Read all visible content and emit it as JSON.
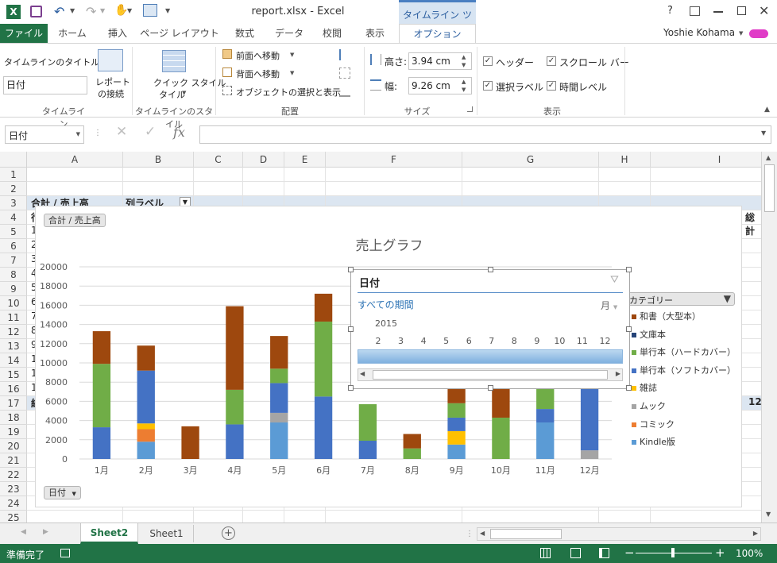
{
  "window": {
    "title": "report.xlsx - Excel",
    "contextual_tab_group": "タイムライン ツール",
    "user": "Yoshie Kohama",
    "help": "?"
  },
  "ribbon_tabs": [
    "ファイル",
    "ホーム",
    "挿入",
    "ページ レイアウト",
    "数式",
    "データ",
    "校閲",
    "表示",
    "オプション"
  ],
  "ribbon": {
    "timeline_group": {
      "caption_label": "タイムラインのタイトル:",
      "caption_value": "日付",
      "connections_label1": "レポート",
      "connections_label2": "の接続",
      "group_label": "タイムライン"
    },
    "styles_group": {
      "quick_styles_label1": "クイック スタイル",
      "quick_styles_label2": "タイル",
      "group_label": "タイムラインのスタイル"
    },
    "arrange_group": {
      "bring_forward": "前面へ移動",
      "send_backward": "背面へ移動",
      "selection_pane": "オブジェクトの選択と表示",
      "group_label": "配置"
    },
    "size_group": {
      "height_label": "高さ:",
      "height_value": "3.94 cm",
      "width_label": "幅:",
      "width_value": "9.26 cm",
      "group_label": "サイズ"
    },
    "show_group": {
      "header": "ヘッダー",
      "selection_label": "選択ラベル",
      "scrollbar": "スクロール バー",
      "time_level": "時間レベル",
      "group_label": "表示"
    }
  },
  "formula_bar": {
    "name_box": "日付",
    "fx": "fx",
    "content": ""
  },
  "columns": [
    "A",
    "B",
    "C",
    "D",
    "E",
    "F",
    "G",
    "H",
    "I"
  ],
  "rows": [
    "1",
    "2",
    "3",
    "4",
    "5",
    "6",
    "7",
    "8",
    "9",
    "10",
    "11",
    "12",
    "13",
    "14",
    "15",
    "16",
    "17",
    "18",
    "19",
    "20",
    "21",
    "22",
    "23",
    "24",
    "25"
  ],
  "cells": {
    "a3": "合計 / 売上高",
    "b3": "列ラベル",
    "a4": "行",
    "a5": "1",
    "a6": "2",
    "a7": "3",
    "a8": "4",
    "a9": "5",
    "a10": "6",
    "a11": "7",
    "a12": "8",
    "a13": "9",
    "a14": "1",
    "a15": "1",
    "a16": "1",
    "a17": "総",
    "j4": "総計",
    "j17": "12"
  },
  "chart": {
    "field_button_top": "合計 / 売上高",
    "field_button_axis": "日付",
    "legend_field": "カテゴリー"
  },
  "chart_data": {
    "type": "bar",
    "stacked": true,
    "title": "売上グラフ",
    "categories": [
      "1月",
      "2月",
      "3月",
      "4月",
      "5月",
      "6月",
      "7月",
      "8月",
      "9月",
      "10月",
      "11月",
      "12月"
    ],
    "ylim": [
      0,
      20000
    ],
    "yticks": [
      "0",
      "2000",
      "4000",
      "6000",
      "8000",
      "10000",
      "12000",
      "14000",
      "16000",
      "18000",
      "20000"
    ],
    "series": [
      {
        "name": "Kindle版",
        "color": "#5b9bd5",
        "values": [
          0,
          1800,
          0,
          0,
          3800,
          0,
          0,
          0,
          1500,
          0,
          3800,
          0
        ]
      },
      {
        "name": "コミック",
        "color": "#ed7d31",
        "values": [
          0,
          1300,
          0,
          0,
          0,
          0,
          0,
          0,
          0,
          0,
          0,
          0
        ]
      },
      {
        "name": "ムック",
        "color": "#a5a5a5",
        "values": [
          0,
          0,
          0,
          0,
          1000,
          0,
          0,
          0,
          0,
          0,
          0,
          900
        ]
      },
      {
        "name": "雑誌",
        "color": "#ffc000",
        "values": [
          0,
          600,
          0,
          0,
          0,
          0,
          0,
          0,
          1400,
          0,
          0,
          0
        ]
      },
      {
        "name": "単行本（ソフトカバー）",
        "color": "#4472c4",
        "values": [
          3300,
          5500,
          0,
          3600,
          3100,
          6500,
          1900,
          0,
          1400,
          0,
          1400,
          6600
        ]
      },
      {
        "name": "単行本（ハードカバー）",
        "color": "#70ad47",
        "values": [
          6600,
          0,
          0,
          3600,
          1500,
          7800,
          3800,
          1100,
          1500,
          4300,
          5800,
          0
        ]
      },
      {
        "name": "文庫本",
        "color": "#264478",
        "values": [
          0,
          0,
          0,
          0,
          0,
          0,
          0,
          0,
          0,
          0,
          0,
          0
        ]
      },
      {
        "name": "和書（大型本）",
        "color": "#9e480e",
        "values": [
          3400,
          2600,
          3400,
          8700,
          3400,
          2900,
          0,
          1500,
          3500,
          4900,
          4300,
          2900
        ]
      }
    ]
  },
  "legend_items": [
    "和書（大型本）",
    "文庫本",
    "単行本（ハードカバー）",
    "単行本（ソフトカバー）",
    "雑誌",
    "ムック",
    "コミック",
    "Kindle版"
  ],
  "legend_colors": [
    "#9e480e",
    "#264478",
    "#70ad47",
    "#4472c4",
    "#ffc000",
    "#a5a5a5",
    "#ed7d31",
    "#5b9bd5"
  ],
  "timeline": {
    "title": "日付",
    "period": "すべての期間",
    "level": "月",
    "year": "2015",
    "months": [
      "2",
      "3",
      "4",
      "5",
      "6",
      "7",
      "8",
      "9",
      "10",
      "11",
      "12"
    ]
  },
  "sheets": [
    "Sheet2",
    "Sheet1"
  ],
  "status": {
    "ready": "準備完了",
    "zoom": "100%"
  }
}
